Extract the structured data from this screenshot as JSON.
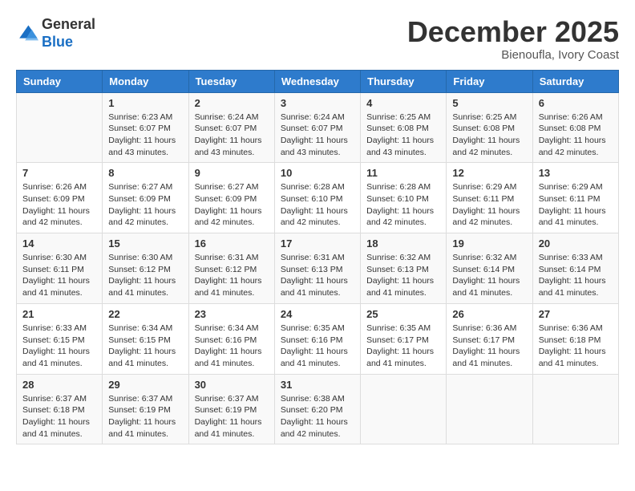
{
  "header": {
    "logo_general": "General",
    "logo_blue": "Blue",
    "month_title": "December 2025",
    "subtitle": "Bienoufla, Ivory Coast"
  },
  "days_of_week": [
    "Sunday",
    "Monday",
    "Tuesday",
    "Wednesday",
    "Thursday",
    "Friday",
    "Saturday"
  ],
  "weeks": [
    [
      {
        "day": "",
        "sunrise": "",
        "sunset": "",
        "daylight": ""
      },
      {
        "day": "1",
        "sunrise": "Sunrise: 6:23 AM",
        "sunset": "Sunset: 6:07 PM",
        "daylight": "Daylight: 11 hours and 43 minutes."
      },
      {
        "day": "2",
        "sunrise": "Sunrise: 6:24 AM",
        "sunset": "Sunset: 6:07 PM",
        "daylight": "Daylight: 11 hours and 43 minutes."
      },
      {
        "day": "3",
        "sunrise": "Sunrise: 6:24 AM",
        "sunset": "Sunset: 6:07 PM",
        "daylight": "Daylight: 11 hours and 43 minutes."
      },
      {
        "day": "4",
        "sunrise": "Sunrise: 6:25 AM",
        "sunset": "Sunset: 6:08 PM",
        "daylight": "Daylight: 11 hours and 43 minutes."
      },
      {
        "day": "5",
        "sunrise": "Sunrise: 6:25 AM",
        "sunset": "Sunset: 6:08 PM",
        "daylight": "Daylight: 11 hours and 42 minutes."
      },
      {
        "day": "6",
        "sunrise": "Sunrise: 6:26 AM",
        "sunset": "Sunset: 6:08 PM",
        "daylight": "Daylight: 11 hours and 42 minutes."
      }
    ],
    [
      {
        "day": "7",
        "sunrise": "Sunrise: 6:26 AM",
        "sunset": "Sunset: 6:09 PM",
        "daylight": "Daylight: 11 hours and 42 minutes."
      },
      {
        "day": "8",
        "sunrise": "Sunrise: 6:27 AM",
        "sunset": "Sunset: 6:09 PM",
        "daylight": "Daylight: 11 hours and 42 minutes."
      },
      {
        "day": "9",
        "sunrise": "Sunrise: 6:27 AM",
        "sunset": "Sunset: 6:09 PM",
        "daylight": "Daylight: 11 hours and 42 minutes."
      },
      {
        "day": "10",
        "sunrise": "Sunrise: 6:28 AM",
        "sunset": "Sunset: 6:10 PM",
        "daylight": "Daylight: 11 hours and 42 minutes."
      },
      {
        "day": "11",
        "sunrise": "Sunrise: 6:28 AM",
        "sunset": "Sunset: 6:10 PM",
        "daylight": "Daylight: 11 hours and 42 minutes."
      },
      {
        "day": "12",
        "sunrise": "Sunrise: 6:29 AM",
        "sunset": "Sunset: 6:11 PM",
        "daylight": "Daylight: 11 hours and 42 minutes."
      },
      {
        "day": "13",
        "sunrise": "Sunrise: 6:29 AM",
        "sunset": "Sunset: 6:11 PM",
        "daylight": "Daylight: 11 hours and 41 minutes."
      }
    ],
    [
      {
        "day": "14",
        "sunrise": "Sunrise: 6:30 AM",
        "sunset": "Sunset: 6:11 PM",
        "daylight": "Daylight: 11 hours and 41 minutes."
      },
      {
        "day": "15",
        "sunrise": "Sunrise: 6:30 AM",
        "sunset": "Sunset: 6:12 PM",
        "daylight": "Daylight: 11 hours and 41 minutes."
      },
      {
        "day": "16",
        "sunrise": "Sunrise: 6:31 AM",
        "sunset": "Sunset: 6:12 PM",
        "daylight": "Daylight: 11 hours and 41 minutes."
      },
      {
        "day": "17",
        "sunrise": "Sunrise: 6:31 AM",
        "sunset": "Sunset: 6:13 PM",
        "daylight": "Daylight: 11 hours and 41 minutes."
      },
      {
        "day": "18",
        "sunrise": "Sunrise: 6:32 AM",
        "sunset": "Sunset: 6:13 PM",
        "daylight": "Daylight: 11 hours and 41 minutes."
      },
      {
        "day": "19",
        "sunrise": "Sunrise: 6:32 AM",
        "sunset": "Sunset: 6:14 PM",
        "daylight": "Daylight: 11 hours and 41 minutes."
      },
      {
        "day": "20",
        "sunrise": "Sunrise: 6:33 AM",
        "sunset": "Sunset: 6:14 PM",
        "daylight": "Daylight: 11 hours and 41 minutes."
      }
    ],
    [
      {
        "day": "21",
        "sunrise": "Sunrise: 6:33 AM",
        "sunset": "Sunset: 6:15 PM",
        "daylight": "Daylight: 11 hours and 41 minutes."
      },
      {
        "day": "22",
        "sunrise": "Sunrise: 6:34 AM",
        "sunset": "Sunset: 6:15 PM",
        "daylight": "Daylight: 11 hours and 41 minutes."
      },
      {
        "day": "23",
        "sunrise": "Sunrise: 6:34 AM",
        "sunset": "Sunset: 6:16 PM",
        "daylight": "Daylight: 11 hours and 41 minutes."
      },
      {
        "day": "24",
        "sunrise": "Sunrise: 6:35 AM",
        "sunset": "Sunset: 6:16 PM",
        "daylight": "Daylight: 11 hours and 41 minutes."
      },
      {
        "day": "25",
        "sunrise": "Sunrise: 6:35 AM",
        "sunset": "Sunset: 6:17 PM",
        "daylight": "Daylight: 11 hours and 41 minutes."
      },
      {
        "day": "26",
        "sunrise": "Sunrise: 6:36 AM",
        "sunset": "Sunset: 6:17 PM",
        "daylight": "Daylight: 11 hours and 41 minutes."
      },
      {
        "day": "27",
        "sunrise": "Sunrise: 6:36 AM",
        "sunset": "Sunset: 6:18 PM",
        "daylight": "Daylight: 11 hours and 41 minutes."
      }
    ],
    [
      {
        "day": "28",
        "sunrise": "Sunrise: 6:37 AM",
        "sunset": "Sunset: 6:18 PM",
        "daylight": "Daylight: 11 hours and 41 minutes."
      },
      {
        "day": "29",
        "sunrise": "Sunrise: 6:37 AM",
        "sunset": "Sunset: 6:19 PM",
        "daylight": "Daylight: 11 hours and 41 minutes."
      },
      {
        "day": "30",
        "sunrise": "Sunrise: 6:37 AM",
        "sunset": "Sunset: 6:19 PM",
        "daylight": "Daylight: 11 hours and 41 minutes."
      },
      {
        "day": "31",
        "sunrise": "Sunrise: 6:38 AM",
        "sunset": "Sunset: 6:20 PM",
        "daylight": "Daylight: 11 hours and 42 minutes."
      },
      {
        "day": "",
        "sunrise": "",
        "sunset": "",
        "daylight": ""
      },
      {
        "day": "",
        "sunrise": "",
        "sunset": "",
        "daylight": ""
      },
      {
        "day": "",
        "sunrise": "",
        "sunset": "",
        "daylight": ""
      }
    ]
  ]
}
